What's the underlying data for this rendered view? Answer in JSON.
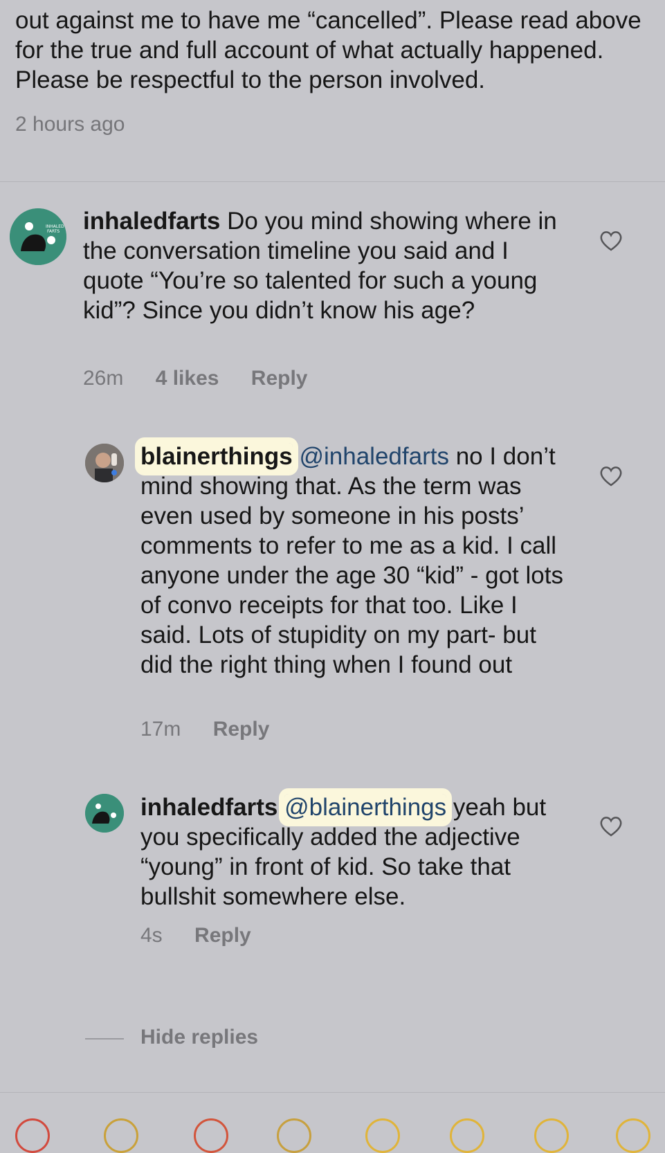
{
  "top_comment": {
    "text": "out against me to have me “cancelled”. Please read above for the true and full account of what actually happened. Please be respectful to the person involved.",
    "timestamp": "2 hours ago"
  },
  "comments": [
    {
      "username": "inhaledfarts",
      "text": " Do you mind showing where in the conversation timeline you said and I quote “You’re so talented for such a young kid”? Since you didn’t know his age?",
      "time": "26m",
      "likes": "4 likes",
      "reply_label": "Reply",
      "avatar_text": [
        "INHALED",
        "FARTS"
      ]
    },
    {
      "username": "blainerthings",
      "mention": "@inhaledfarts",
      "text": " no I don’t mind showing that. As the term was even used by someone in his posts’ comments to refer to me as a kid. I call anyone under the age 30 “kid” - got lots of convo receipts for that too. Like I said. Lots of stupidity on my part- but did the right thing when I found out",
      "time": "17m",
      "reply_label": "Reply"
    },
    {
      "username": "inhaledfarts",
      "mention": "@blainerthings",
      "text": " yeah but you specifically added the adjective “young” in front of kid. So take that bullshit somewhere else.",
      "time": "4s",
      "reply_label": "Reply"
    }
  ],
  "hide_replies_label": "Hide replies",
  "icons": {
    "like": "heart-icon"
  },
  "colors": {
    "background": "#c6c6cb",
    "highlight": "#fbf7dc",
    "avatar_teal": "#3a8f79",
    "mention": "#20446b"
  }
}
